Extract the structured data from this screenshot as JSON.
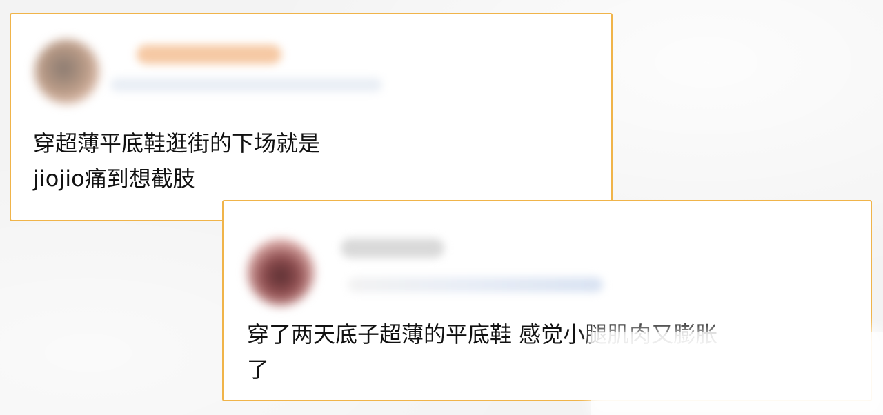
{
  "comments": [
    {
      "text": "穿超薄平底鞋逛街的下场就是\njiojio痛到想截肢"
    },
    {
      "text": "穿了两天底子超薄的平底鞋 感觉小腿肌肉又膨胀\n了"
    }
  ],
  "colors": {
    "background": "#f4f4f4",
    "card_background": "#ffffff",
    "card_border": "#f0b44a",
    "text": "#111111"
  }
}
